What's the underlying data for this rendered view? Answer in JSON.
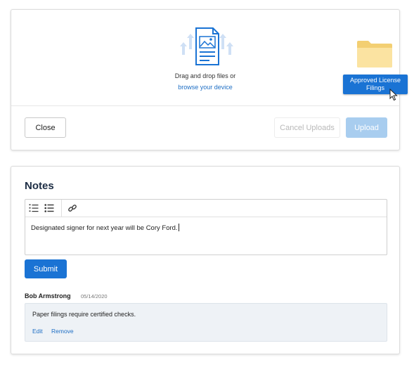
{
  "upload": {
    "drag_text": "Drag and drop files or",
    "browse_link": "browse your device",
    "tooltip": "Approved License Filings",
    "close_label": "Close",
    "cancel_label": "Cancel Uploads",
    "upload_label": "Upload"
  },
  "notes": {
    "title": "Notes",
    "editor_value": "Designated signer for next year will be Cory Ford.",
    "submit_label": "Submit",
    "entries": [
      {
        "author": "Bob Armstrong",
        "date": "05/14/2020",
        "text": "Paper filings require certified checks.",
        "edit_label": "Edit",
        "remove_label": "Remove"
      }
    ]
  },
  "colors": {
    "primary": "#1a73d4",
    "primary_disabled": "#a8cdef",
    "folder": "#fbe3a1",
    "note_bg": "#eef2f6"
  },
  "icons": [
    "file-image-upload-icon",
    "folder-icon",
    "pointer-cursor-icon",
    "numbered-list-icon",
    "bulleted-list-icon",
    "link-icon"
  ]
}
